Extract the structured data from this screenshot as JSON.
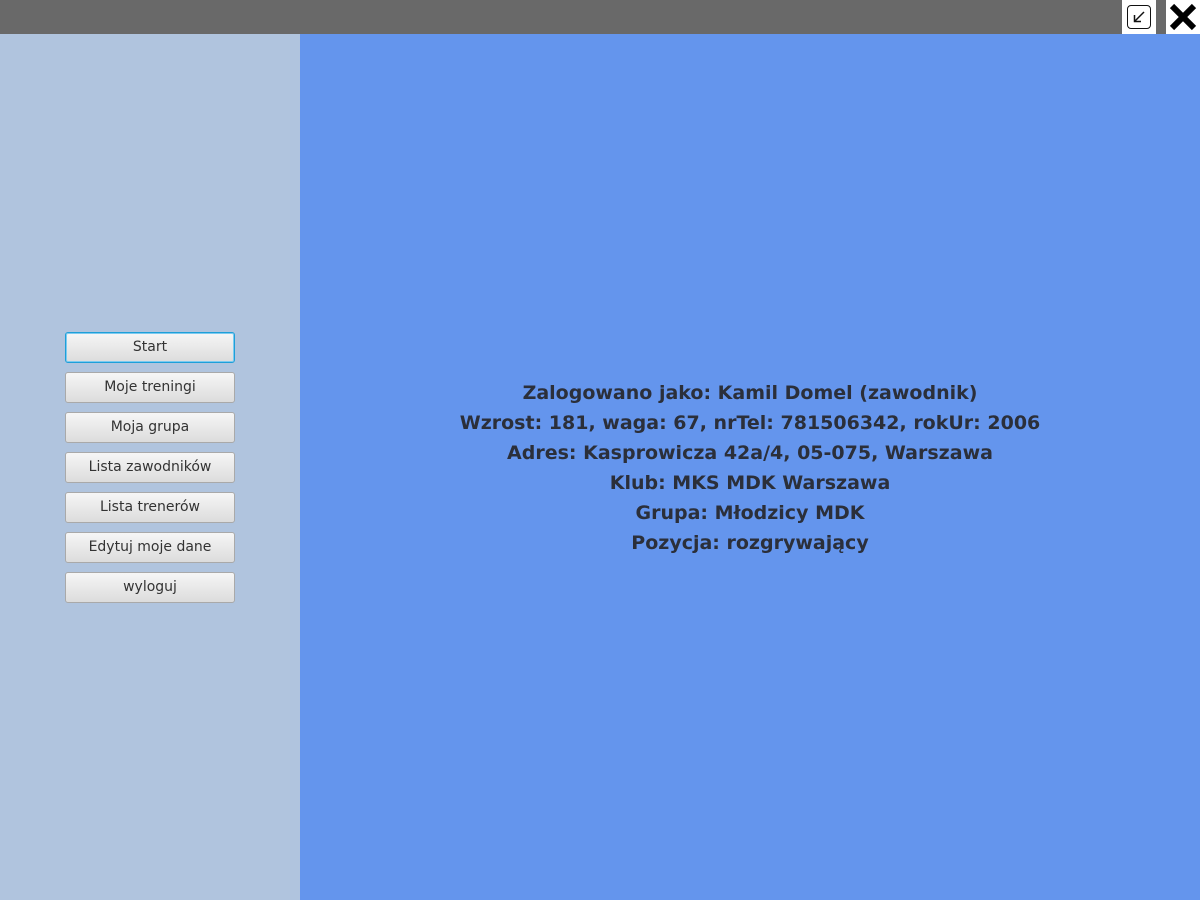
{
  "window": {
    "minimize_icon": "minimize-arrow-icon",
    "close_icon": "close-x-icon"
  },
  "sidebar": {
    "buttons": [
      {
        "label": "Start",
        "focused": true
      },
      {
        "label": "Moje treningi"
      },
      {
        "label": "Moja grupa"
      },
      {
        "label": "Lista zawodników"
      },
      {
        "label": "Lista trenerów"
      },
      {
        "label": "Edytuj moje dane"
      },
      {
        "label": "wyloguj"
      }
    ]
  },
  "profile": {
    "lines": [
      "Zalogowano jako: Kamil Domel (zawodnik)",
      "Wzrost: 181, waga: 67, nrTel: 781506342, rokUr: 2006",
      "Adres: Kasprowicza 42a/4, 05-075, Warszawa",
      "Klub: MKS MDK Warszawa",
      "Grupa: Młodzicy MDK",
      "Pozycja: rozgrywający"
    ]
  },
  "colors": {
    "titlebar": "#696969",
    "sidebar": "#b0c4de",
    "main": "#6495ed",
    "text": "#2b2f3a",
    "focus_border": "#1e9fd8"
  }
}
